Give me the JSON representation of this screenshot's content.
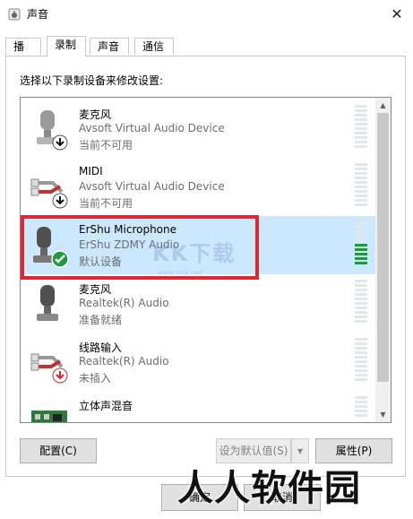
{
  "window": {
    "title": "声音",
    "close_glyph": "✕"
  },
  "tabs": [
    {
      "label": "播放",
      "active": false
    },
    {
      "label": "录制",
      "active": true
    },
    {
      "label": "声音",
      "active": false
    },
    {
      "label": "通信",
      "active": false
    }
  ],
  "instruction": "选择以下录制设备来修改设置:",
  "devices": [
    {
      "name": "麦克风",
      "driver": "Avsoft Virtual Audio Device",
      "state": "当前不可用",
      "icon": "microphone-icon",
      "badge": "down-arrow-badge",
      "selected": false,
      "level_on": 0
    },
    {
      "name": "MIDI",
      "driver": "Avsoft Virtual Audio Device",
      "state": "当前不可用",
      "icon": "rca-cable-icon",
      "badge": "down-arrow-badge",
      "selected": false,
      "level_on": 0
    },
    {
      "name": "ErShu Microphone",
      "driver": "ErShu ZDMY Audio",
      "state": "默认设备",
      "icon": "microphone-icon",
      "badge": "green-check-badge",
      "selected": true,
      "level_on": 5
    },
    {
      "name": "麦克风",
      "driver": "Realtek(R) Audio",
      "state": "准备就绪",
      "icon": "microphone-icon",
      "badge": "",
      "selected": false,
      "level_on": 0
    },
    {
      "name": "线路输入",
      "driver": "Realtek(R) Audio",
      "state": "未插入",
      "icon": "rca-cable-icon",
      "badge": "red-down-arrow-badge",
      "selected": false,
      "level_on": 0
    },
    {
      "name": "立体声混音",
      "driver": "",
      "state": "",
      "icon": "sound-card-icon",
      "badge": "",
      "selected": false,
      "level_on": 0
    }
  ],
  "buttons": {
    "configure": "配置(C)",
    "set_default": "设为默认值(S)",
    "properties": "属性(P)"
  },
  "footer": {
    "ok": "确定",
    "cancel": "取消"
  },
  "watermarks": {
    "center": "KK下载",
    "center_url": "www.kkx.net",
    "corner": "人人软件园"
  },
  "colors": {
    "selection": "#cce8ff",
    "highlight_border": "#e0262e",
    "level_active": "#1e9c3c"
  }
}
